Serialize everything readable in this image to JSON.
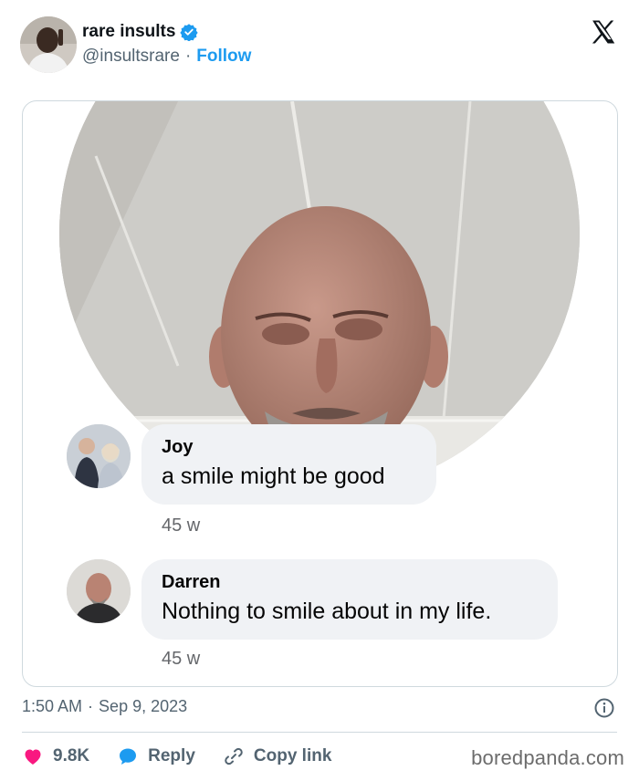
{
  "author": {
    "display_name": "rare insults",
    "handle": "@insultsrare",
    "separator": "·",
    "follow_label": "Follow",
    "verified": true
  },
  "post": {
    "comments": [
      {
        "name": "Joy",
        "text": "a smile might be good",
        "time": "45 w"
      },
      {
        "name": "Darren",
        "text": "Nothing to smile about in my life.",
        "time": "45 w"
      }
    ],
    "time": "1:50 AM",
    "separator": "·",
    "date": "Sep 9, 2023"
  },
  "actions": {
    "likes": "9.8K",
    "reply_label": "Reply",
    "copy_label": "Copy link"
  },
  "watermark": "boredpanda.com",
  "colors": {
    "like": "#f91880",
    "reply": "#1d9bf0",
    "accent": "#1d9bf0",
    "text_secondary": "#536471",
    "bubble": "#f0f2f5"
  },
  "icons": [
    "verified-badge-icon",
    "x-logo-icon",
    "info-icon",
    "heart-icon",
    "reply-bubble-icon",
    "link-icon"
  ]
}
